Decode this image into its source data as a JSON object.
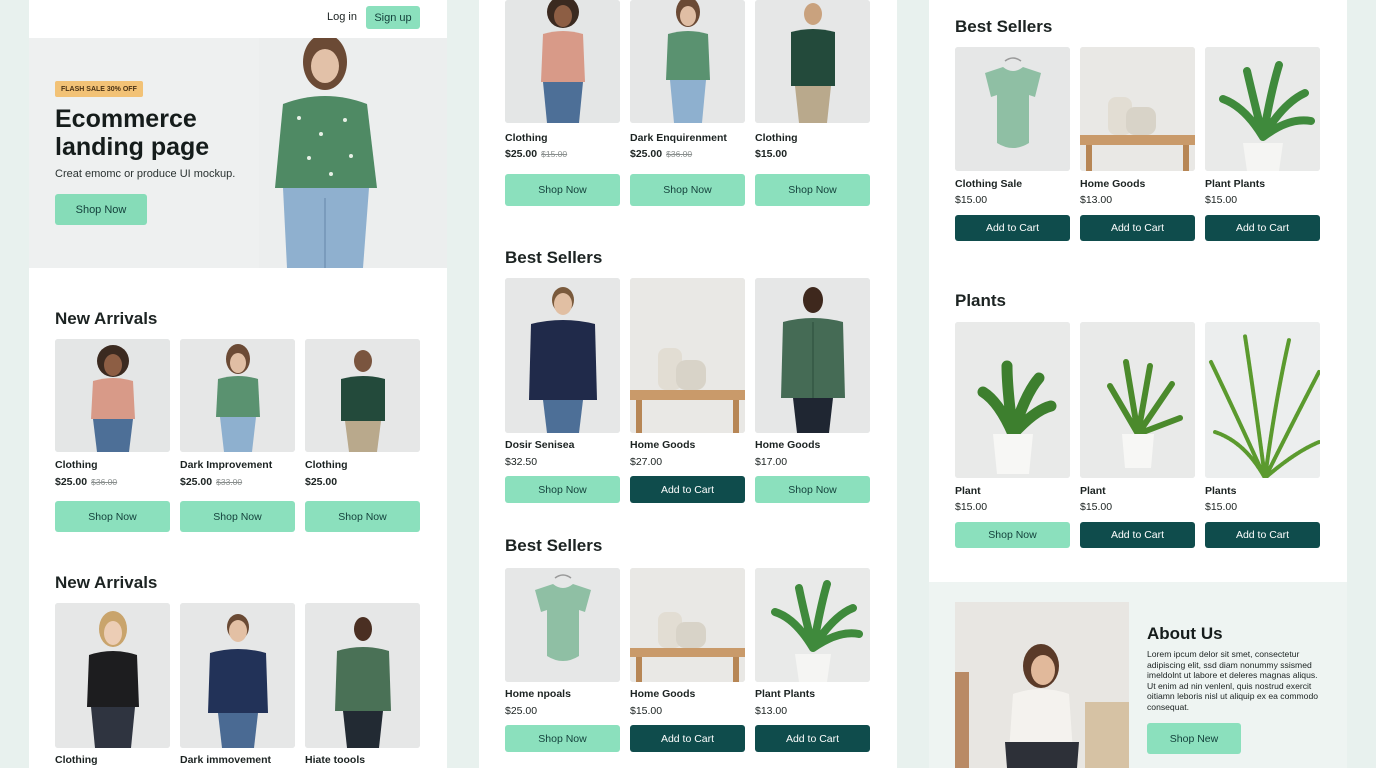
{
  "header": {
    "login_label": "Log in",
    "signup_label": "Sign up"
  },
  "hero": {
    "badge": "FLASH SALE 30% OFF",
    "title": "Ecommerce landing page",
    "subtitle": "Creat emomc or produce UI mockup.",
    "cta_label": "Shop Now"
  },
  "col1": {
    "section1_title": "New Arrivals",
    "section1_items": [
      {
        "name": "Clothing",
        "price": "$25.00",
        "old_price": "$36.00",
        "button": "Shop Now"
      },
      {
        "name": "Dark Improvement",
        "price": "$25.00",
        "old_price": "$33.00",
        "button": "Shop Now"
      },
      {
        "name": "Clothing",
        "price": "$25.00",
        "old_price": "",
        "button": "Shop Now"
      }
    ],
    "section2_title": "New Arrivals",
    "section2_items": [
      {
        "name": "Clothing"
      },
      {
        "name": "Dark immovement"
      },
      {
        "name": "Hiate toools"
      }
    ]
  },
  "col2": {
    "top_items": [
      {
        "name": "Clothing",
        "price": "$25.00",
        "old_price": "$15.00",
        "button": "Shop Now"
      },
      {
        "name": "Dark Enquirenment",
        "price": "$25.00",
        "old_price": "$36.00",
        "button": "Shop Now"
      },
      {
        "name": "Clothing",
        "price": "$15.00",
        "old_price": "",
        "button": "Shop Now"
      }
    ],
    "section1_title": "Best Sellers",
    "section1_items": [
      {
        "name": "Dosir Senisea",
        "price": "$32.50",
        "button": "Shop Now"
      },
      {
        "name": "Home Goods",
        "price": "$27.00",
        "button": "Add to Cart"
      },
      {
        "name": "Home Goods",
        "price": "$17.00",
        "button": "Shop Now"
      }
    ],
    "section2_title": "Best Sellers",
    "section2_items": [
      {
        "name": "Home npoals",
        "price": "$25.00",
        "button": "Shop Now"
      },
      {
        "name": "Home Goods",
        "price": "$15.00",
        "button": "Add to Cart"
      },
      {
        "name": "Plant Plants",
        "price": "$13.00",
        "button": "Add to Cart"
      }
    ]
  },
  "col3": {
    "section1_title": "Best Sellers",
    "section1_items": [
      {
        "name": "Clothing Sale",
        "price": "$15.00",
        "button": "Add to Cart"
      },
      {
        "name": "Home Goods",
        "price": "$13.00",
        "button": "Add to Cart"
      },
      {
        "name": "Plant Plants",
        "price": "$15.00",
        "button": "Add to Cart"
      }
    ],
    "section2_title": "Plants",
    "section2_items": [
      {
        "name": "Plant",
        "price": "$15.00",
        "button": "Shop Now"
      },
      {
        "name": "Plant",
        "price": "$15.00",
        "button": "Add to Cart"
      },
      {
        "name": "Plants",
        "price": "$15.00",
        "button": "Add to Cart"
      }
    ],
    "about": {
      "title": "About Us",
      "text": "Lorem ipcum delor sit smet, consectetur adipiscing elit, ssd diam nonummy ssismed imeldolnt ut labore et deleres magnas aliqus. Ut enim ad nin venlenl, quis nostrud exercit oitiamn leboris nisl ut aliquip ex ea commodo consequat.",
      "button": "Shop New"
    }
  },
  "colors": {
    "mint": "#8be0bd",
    "dark_teal": "#0f4c4c",
    "badge": "#f2c276",
    "background": "#e8f1ee"
  }
}
